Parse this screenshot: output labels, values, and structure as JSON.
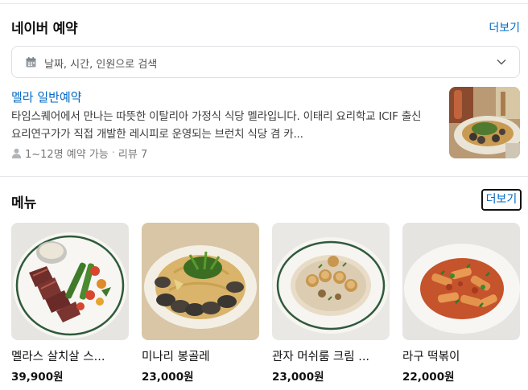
{
  "reservation": {
    "title": "네이버 예약",
    "more_label": "더보기",
    "search_placeholder": "날짜, 시간, 인원으로 검색",
    "booking_name": "멜라 일반예약",
    "booking_desc": "타임스퀘어에서 만나는 따뜻한 이탈리아 가정식 식당 멜라입니다. 이태리 요리학교 ICIF 출신 요리연구가가 직접 개발한 레시피로 운영되는 브런치 식당 겸 카...",
    "capacity": "1~12명 예약 가능",
    "reviews": "리뷰 7"
  },
  "menu": {
    "title": "메뉴",
    "more_label": "더보기",
    "items": [
      {
        "name": "멜라스 살치살 스...",
        "price": "39,900원"
      },
      {
        "name": "미나리 봉골레",
        "price": "23,000원"
      },
      {
        "name": "관자 머쉬룸 크림 ...",
        "price": "23,000원"
      },
      {
        "name": "라구 떡볶이",
        "price": "22,000원"
      }
    ]
  },
  "icons": [
    "calendar-icon",
    "chevron-down-icon",
    "person-icon"
  ],
  "colors": {
    "link": "#0068c3",
    "border": "#dcdfe3"
  }
}
